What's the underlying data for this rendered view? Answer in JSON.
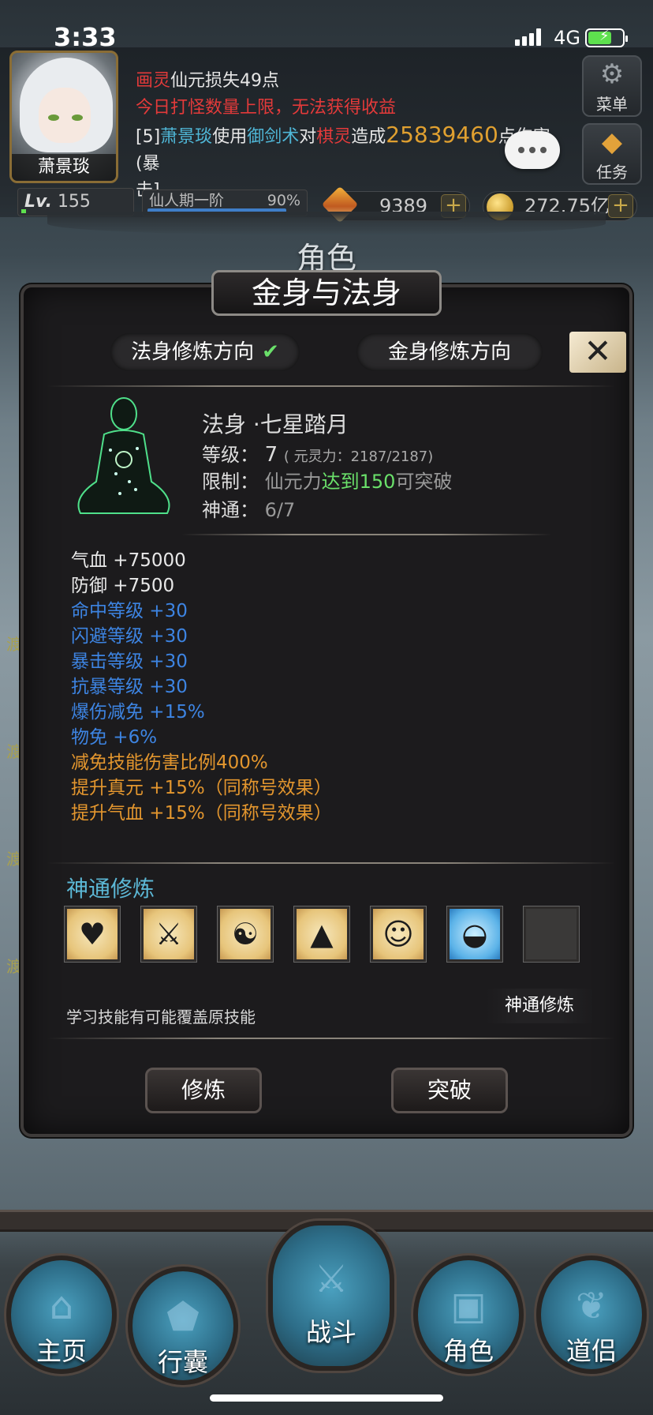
{
  "status": {
    "time": "3:33",
    "network": "4G"
  },
  "player": {
    "name": "萧景琰",
    "level_prefix": "Lv.",
    "level": "155",
    "stage": "仙人期一阶",
    "stage_percent": "90%",
    "stage_progress": 0.9
  },
  "log": {
    "line1_name": "画灵",
    "line1_text": "仙元损失49点",
    "line2": "今日打怪数量上限，无法获得收益",
    "line3_prefix": "[5]",
    "line3_actor": "萧景琰",
    "line3_use": "使用",
    "line3_skill": "御剑术",
    "line3_to": "对",
    "line3_target": "棋灵",
    "line3_cause": "造成",
    "line3_damage": "25839460",
    "line3_tail": "点伤害(暴",
    "line4": "击]"
  },
  "side_buttons": {
    "menu": "菜单",
    "tasks": "任务"
  },
  "resources": {
    "gems": "9389",
    "coins": "272.75亿",
    "plus": "+"
  },
  "screen_title": "角色",
  "panel": {
    "title": "金身与法身",
    "close": "✕",
    "tabs": {
      "fashen": "法身修炼方向",
      "jinshen": "金身修炼方向",
      "check": "✔"
    },
    "info": {
      "name": "法身 ·七星踏月",
      "level_label": "等级：",
      "level_value": "7",
      "level_extra": "( 元灵力：2187/2187)",
      "limit_label": "限制：",
      "limit_prefix": "仙元力",
      "limit_highlight": "达到150",
      "limit_suffix": "可突破",
      "power_label": "神通：",
      "power_value": "6/7"
    },
    "stats": [
      {
        "text": "气血 +75000",
        "color": "white"
      },
      {
        "text": "防御 +7500",
        "color": "white"
      },
      {
        "text": "命中等级 +30",
        "color": "blue"
      },
      {
        "text": "闪避等级 +30",
        "color": "blue"
      },
      {
        "text": "暴击等级 +30",
        "color": "blue"
      },
      {
        "text": "抗暴等级 +30",
        "color": "blue"
      },
      {
        "text": "爆伤减免 +15%",
        "color": "blue"
      },
      {
        "text": "物免 +6%",
        "color": "blue"
      },
      {
        "text": "减免技能伤害比例400%",
        "color": "orange"
      },
      {
        "text": "提升真元 +15%（同称号效果）",
        "color": "orange"
      },
      {
        "text": "提升气血 +15%（同称号效果）",
        "color": "orange"
      }
    ],
    "section_title": "神通修炼",
    "skills": [
      "heart-pulse-icon",
      "sword-cloud-icon",
      "meditation-icon",
      "mountain-cloud-icon",
      "warrior-icon",
      "ingot-icon",
      "empty-slot"
    ],
    "hint": "学习技能有可能覆盖原技能",
    "train_link": "神通修炼",
    "buttons": {
      "train": "修炼",
      "breakthrough": "突破"
    }
  },
  "side_text": [
    "渡",
    "渡",
    "渡",
    "渡"
  ],
  "nav": {
    "home": "主页",
    "bag": "行囊",
    "battle": "战斗",
    "role": "角色",
    "partner": "道侣"
  }
}
